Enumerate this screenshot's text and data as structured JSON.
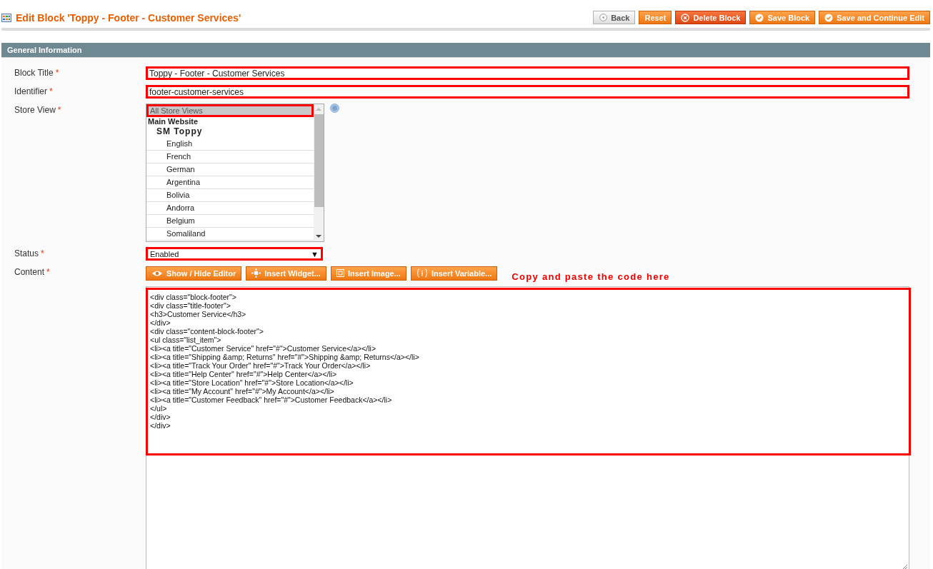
{
  "page_title": "Edit Block 'Toppy - Footer - Customer Services'",
  "header_buttons": [
    {
      "label": "Back",
      "kind": "back"
    },
    {
      "label": "Reset",
      "kind": "plain"
    },
    {
      "label": "Delete Block",
      "kind": "delete"
    },
    {
      "label": "Save Block",
      "kind": "save"
    },
    {
      "label": "Save and Continue Edit",
      "kind": "save"
    }
  ],
  "section": {
    "title": "General Information"
  },
  "fields": [
    {
      "kind": "text",
      "label": "Block Title",
      "required_mark": "*",
      "value": "Toppy - Footer - Customer Services",
      "highlighted": true
    },
    {
      "kind": "text",
      "label": "Identifier",
      "required_mark": "*",
      "value": "footer-customer-services",
      "highlighted": true
    },
    {
      "kind": "listbox",
      "label": "Store View",
      "required_mark": "*",
      "help": true,
      "options": [
        {
          "kind": "option",
          "label": "All Store Views",
          "selected": true,
          "highlighted": true
        },
        {
          "kind": "website",
          "label": "Main Website"
        },
        {
          "kind": "store",
          "label": "SM Toppy"
        },
        {
          "kind": "option",
          "label": "English",
          "selected": false,
          "highlighted": false
        },
        {
          "kind": "option",
          "label": "French",
          "selected": false,
          "highlighted": false
        },
        {
          "kind": "option",
          "label": "German",
          "selected": false,
          "highlighted": false
        },
        {
          "kind": "option",
          "label": "Argentina",
          "selected": false,
          "highlighted": false
        },
        {
          "kind": "option",
          "label": "Bolivia",
          "selected": false,
          "highlighted": false
        },
        {
          "kind": "option",
          "label": "Andorra",
          "selected": false,
          "highlighted": false
        },
        {
          "kind": "option",
          "label": "Belgium",
          "selected": false,
          "highlighted": false
        },
        {
          "kind": "option",
          "label": "Somaliland",
          "selected": false,
          "highlighted": false
        }
      ]
    },
    {
      "kind": "select",
      "label": "Status",
      "required_mark": "*",
      "value": "Enabled",
      "caret": "▼",
      "highlighted": true
    },
    {
      "kind": "editor",
      "label": "Content",
      "required_mark": "*",
      "buttons": [
        {
          "label": "Show / Hide Editor",
          "kind": "eye"
        },
        {
          "label": "Insert Widget...",
          "kind": "widget"
        },
        {
          "label": "Insert Image...",
          "kind": "image"
        },
        {
          "label": "Insert Variable...",
          "kind": "variable"
        }
      ],
      "annotation": "Copy and paste the code here",
      "highlighted": true,
      "lines": [
        "<div class=\"block-footer\">",
        "<div class=\"title-footer\">",
        "<h3>Customer Service</h3>",
        "</div>",
        "<div class=\"content-block-footer\">",
        "<ul class=\"list_item\">",
        "<li><a title=\"Customer Service\" href=\"#\">Customer Service</a></li>",
        "<li><a title=\"Shipping &amp; Returns\" href=\"#\">Shipping &amp; Returns</a></li>",
        "<li><a title=\"Track Your Order\" href=\"#\">Track Your Order</a></li>",
        "<li><a title=\"Help Center\" href=\"#\">Help Center</a></li>",
        "<li><a title=\"Store Location\" href=\"#\">Store Location</a></li>",
        "<li><a title=\"My Account\" href=\"#\">My Account</a></li>",
        "<li><a title=\"Customer Feedback\" href=\"#\">Customer Feedback</a></li>",
        "</ul>",
        "</div>",
        "</div>"
      ]
    }
  ]
}
